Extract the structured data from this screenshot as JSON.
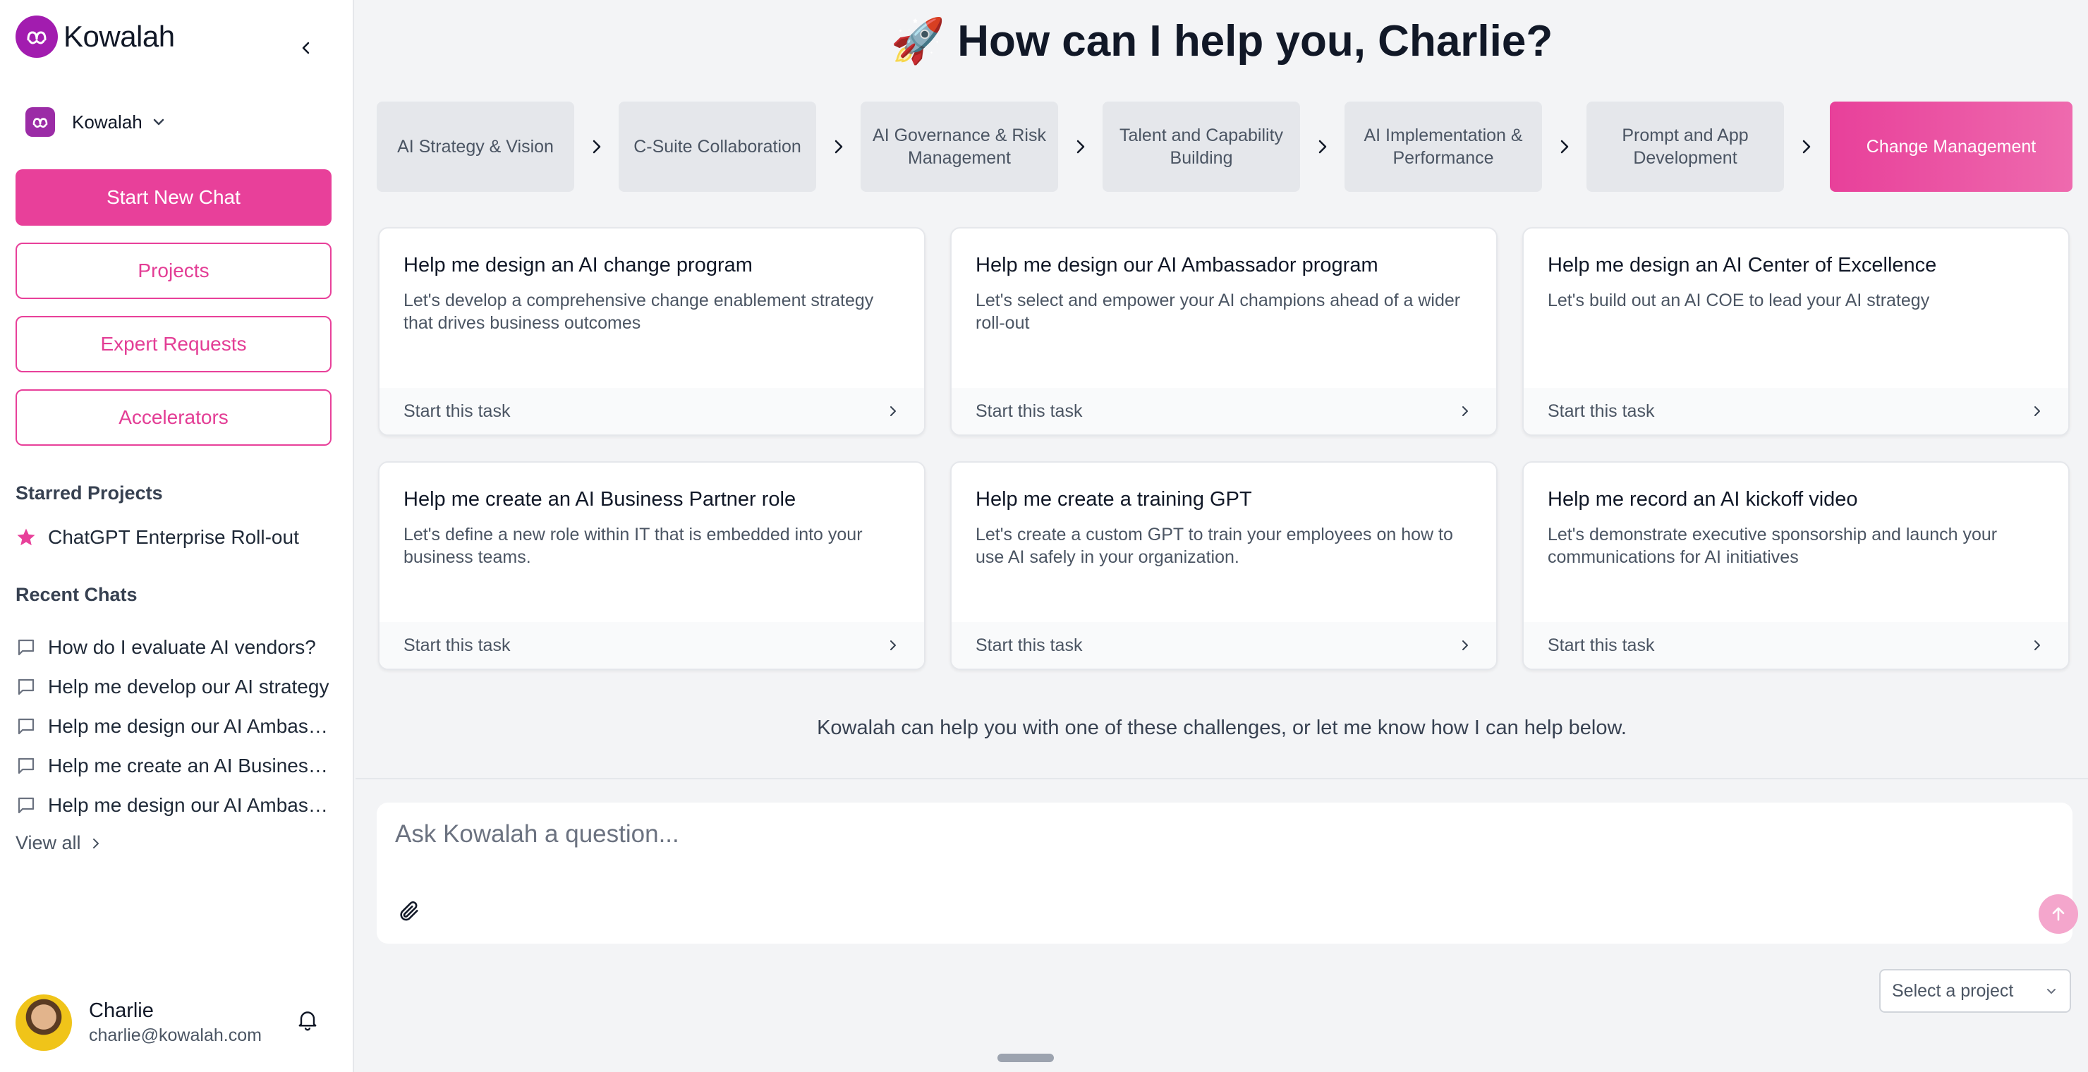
{
  "app": {
    "brand_name": "Kowalah",
    "accent_color": "#e8409a"
  },
  "sidebar": {
    "workspace_name": "Kowalah",
    "start_chat_label": "Start New Chat",
    "projects_label": "Projects",
    "expert_requests_label": "Expert Requests",
    "accelerators_label": "Accelerators",
    "starred_title": "Starred Projects",
    "starred_items": [
      {
        "label": "ChatGPT Enterprise Roll-out",
        "icon": "star-icon"
      }
    ],
    "recent_title": "Recent Chats",
    "recent_chats": [
      {
        "label": "How do I evaluate AI vendors?",
        "icon": "chat-bubble-icon"
      },
      {
        "label": "Help me develop our AI strategy",
        "icon": "chat-bubble-icon"
      },
      {
        "label": "Help me design our AI Ambassador program",
        "icon": "chat-bubble-icon"
      },
      {
        "label": "Help me create an AI Business Partner role",
        "icon": "chat-bubble-icon"
      },
      {
        "label": "Help me design our AI Ambassador program",
        "icon": "chat-bubble-icon"
      }
    ],
    "view_all_label": "View all",
    "user": {
      "name": "Charlie",
      "email": "charlie@kowalah.com"
    }
  },
  "main": {
    "greeting_emoji": "🚀",
    "greeting": "How can I help you, Charlie?",
    "categories": [
      {
        "label": "AI Strategy & Vision",
        "active": false
      },
      {
        "label": "C-Suite Collaboration",
        "active": false
      },
      {
        "label": "AI Governance & Risk Management",
        "active": false
      },
      {
        "label": "Talent and Capability Building",
        "active": false
      },
      {
        "label": "AI Implementation & Performance",
        "active": false
      },
      {
        "label": "Prompt and App Development",
        "active": false
      },
      {
        "label": "Change Management",
        "active": true
      }
    ],
    "cards": [
      {
        "title": "Help me design an AI change program",
        "description": "Let's develop a comprehensive change enablement strategy that drives business outcomes",
        "action": "Start this task"
      },
      {
        "title": "Help me design our AI Ambassador program",
        "description": "Let's select and empower your AI champions ahead of a wider roll-out",
        "action": "Start this task"
      },
      {
        "title": "Help me design an AI Center of Excellence",
        "description": "Let's build out an AI COE to lead your AI strategy",
        "action": "Start this task"
      },
      {
        "title": "Help me create an AI Business Partner role",
        "description": "Let's define a new role within IT that is embedded into your business teams.",
        "action": "Start this task"
      },
      {
        "title": "Help me create a training GPT",
        "description": "Let's create a custom GPT to train your employees on how to use AI safely in your organization.",
        "action": "Start this task"
      },
      {
        "title": "Help me record an AI kickoff video",
        "description": "Let's demonstrate executive sponsorship and launch your communications for AI initiatives",
        "action": "Start this task"
      }
    ],
    "helper_text": "Kowalah can help you with one of these challenges, or let me know how I can help below.",
    "ask_placeholder": "Ask Kowalah a question...",
    "project_select_label": "Select a project"
  }
}
